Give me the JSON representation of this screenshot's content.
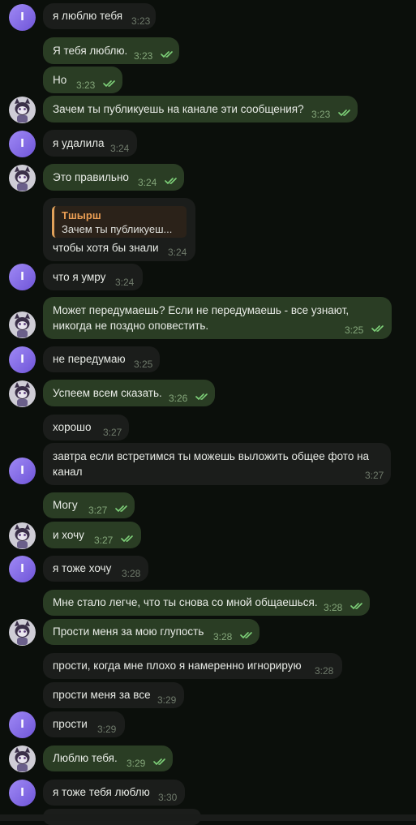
{
  "messages": [
    {
      "text": "я люблю тебя",
      "time": "3:23"
    },
    {
      "text": "Я тебя люблю.",
      "time": "3:23"
    },
    {
      "text": "Но",
      "time": "3:23"
    },
    {
      "text": "Зачем ты публикуешь на канале эти сообщения?",
      "time": "3:23"
    },
    {
      "text": "я удалила",
      "time": "3:24"
    },
    {
      "text": "Это правильно",
      "time": "3:24"
    },
    {
      "text": "чтобы хотя бы знали",
      "time": "3:24",
      "reply": {
        "name": "Тшырш",
        "text": "Зачем ты публикуеш..."
      }
    },
    {
      "text": "что я умру",
      "time": "3:24"
    },
    {
      "lines": [
        "Может передумаешь? Если не передумаешь - все узнают,",
        "никогда не поздно оповестить."
      ],
      "time": "3:25"
    },
    {
      "text": "не передумаю",
      "time": "3:25"
    },
    {
      "text": "Успеем всем сказать.",
      "time": "3:26"
    },
    {
      "text": "хорошо",
      "time": "3:27"
    },
    {
      "lines": [
        "завтра если встретимся ты можешь выложить общее фото на",
        "канал"
      ],
      "time": "3:27"
    },
    {
      "text": "Могу",
      "time": "3:27"
    },
    {
      "text": "и хочу",
      "time": "3:27"
    },
    {
      "text": "я тоже хочу",
      "time": "3:28"
    },
    {
      "text": "Мне стало легче, что ты снова со мной общаешься.",
      "time": "3:28"
    },
    {
      "text": "Прости меня за мою глупость",
      "time": "3:28"
    },
    {
      "text": "прости, когда мне плохо я намеренно игнорирую",
      "time": "3:28"
    },
    {
      "text": "прости меня за все",
      "time": "3:29"
    },
    {
      "text": "прости",
      "time": "3:29"
    },
    {
      "text": "Люблю тебя.",
      "time": "3:29"
    },
    {
      "text": "я тоже тебя люблю",
      "time": "3:30"
    }
  ],
  "avatars": {
    "user_initial": "I",
    "user_color": "#8a72ea",
    "partner_icon": "cat-character-avatar-icon"
  },
  "colors": {
    "incoming": "#1b1d1b",
    "outgoing": "#2a3d24",
    "read_checks": "#7fd27a",
    "reply_accent": "#e0a15a"
  }
}
